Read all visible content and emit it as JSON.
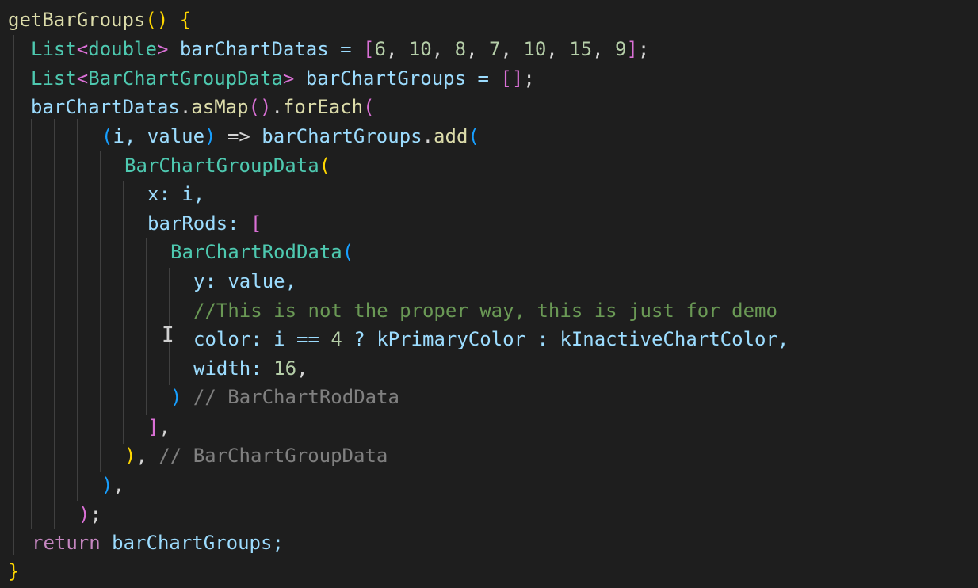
{
  "editor": {
    "background": "#1e1e1e",
    "palette": {
      "fn": "#dcdcaa",
      "type": "#4ec9b0",
      "var": "#9cdcfe",
      "num": "#b5cea8",
      "op": "#d4d4d4",
      "kw": "#c586c0",
      "comment": "#6a9955",
      "hint": "#808080",
      "b1": "#ffd700",
      "b2": "#da70d6",
      "b3": "#179fff"
    },
    "lines": [
      [
        [
          "getBarGroups",
          "fn"
        ],
        [
          "()",
          "b1"
        ],
        [
          " ",
          "op"
        ],
        [
          "{",
          "b1"
        ]
      ],
      [
        [
          "List",
          "type"
        ],
        [
          "<",
          "b2"
        ],
        [
          "double",
          "type"
        ],
        [
          ">",
          "b2"
        ],
        [
          " barChartDatas = ",
          "var"
        ],
        [
          "[",
          "b2"
        ],
        [
          "6",
          "num"
        ],
        [
          ", ",
          "op"
        ],
        [
          "10",
          "num"
        ],
        [
          ", ",
          "op"
        ],
        [
          "8",
          "num"
        ],
        [
          ", ",
          "op"
        ],
        [
          "7",
          "num"
        ],
        [
          ", ",
          "op"
        ],
        [
          "10",
          "num"
        ],
        [
          ", ",
          "op"
        ],
        [
          "15",
          "num"
        ],
        [
          ", ",
          "op"
        ],
        [
          "9",
          "num"
        ],
        [
          "]",
          "b2"
        ],
        [
          ";",
          "op"
        ]
      ],
      [
        [
          "List",
          "type"
        ],
        [
          "<",
          "b2"
        ],
        [
          "BarChartGroupData",
          "type"
        ],
        [
          ">",
          "b2"
        ],
        [
          " barChartGroups = ",
          "var"
        ],
        [
          "[]",
          "b2"
        ],
        [
          ";",
          "op"
        ]
      ],
      [
        [
          "barChartDatas",
          "var"
        ],
        [
          ".",
          "op"
        ],
        [
          "asMap",
          "fn"
        ],
        [
          "()",
          "b2"
        ],
        [
          ".",
          "op"
        ],
        [
          "forEach",
          "fn"
        ],
        [
          "(",
          "b2"
        ]
      ],
      [
        [
          "(",
          "b3"
        ],
        [
          "i, value",
          "var"
        ],
        [
          ")",
          "b3"
        ],
        [
          " => ",
          "op"
        ],
        [
          "barChartGroups",
          "var"
        ],
        [
          ".",
          "op"
        ],
        [
          "add",
          "fn"
        ],
        [
          "(",
          "b3"
        ]
      ],
      [
        [
          "BarChartGroupData",
          "type"
        ],
        [
          "(",
          "b1"
        ]
      ],
      [
        [
          "x: i,",
          "var"
        ]
      ],
      [
        [
          "barRods: ",
          "var"
        ],
        [
          "[",
          "b2"
        ]
      ],
      [
        [
          "BarChartRodData",
          "type"
        ],
        [
          "(",
          "b3"
        ]
      ],
      [
        [
          "y: value,",
          "var"
        ]
      ],
      [
        [
          "//This is not the proper way, this is just for demo",
          "comment"
        ]
      ],
      [
        [
          "color: i == ",
          "var"
        ],
        [
          "4",
          "num"
        ],
        [
          " ? kPrimaryColor : kInactiveChartColor,",
          "var"
        ]
      ],
      [
        [
          "width: ",
          "var"
        ],
        [
          "16",
          "num"
        ],
        [
          ",",
          "op"
        ]
      ],
      [
        [
          ")",
          "b3"
        ],
        [
          " // BarChartRodData",
          "hint"
        ]
      ],
      [
        [
          "]",
          "b2"
        ],
        [
          ",",
          "op"
        ]
      ],
      [
        [
          ")",
          "b1"
        ],
        [
          ", ",
          "op"
        ],
        [
          "// BarChartGroupData",
          "hint"
        ]
      ],
      [
        [
          ")",
          "b3"
        ],
        [
          ",",
          "op"
        ]
      ],
      [
        [
          ")",
          "b2"
        ],
        [
          ";",
          "op"
        ]
      ],
      [
        [
          "return",
          "kw"
        ],
        [
          " barChartGroups;",
          "var"
        ]
      ],
      [
        [
          "}",
          "b1"
        ]
      ]
    ],
    "cursor_glyph": "I"
  }
}
